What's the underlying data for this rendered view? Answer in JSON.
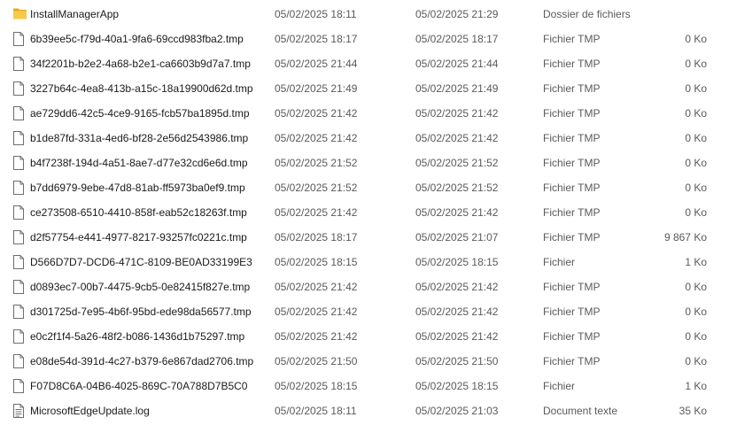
{
  "files": [
    {
      "icon": "folder-icon",
      "name": "InstallManagerApp",
      "created": "05/02/2025 18:11",
      "modified": "05/02/2025 21:29",
      "type": "Dossier de fichiers",
      "size": ""
    },
    {
      "icon": "file-icon",
      "name": "6b39ee5c-f79d-40a1-9fa6-69ccd983fba2.tmp",
      "created": "05/02/2025 18:17",
      "modified": "05/02/2025 18:17",
      "type": "Fichier TMP",
      "size": "0 Ko"
    },
    {
      "icon": "file-icon",
      "name": "34f2201b-b2e2-4a68-b2e1-ca6603b9d7a7.tmp",
      "created": "05/02/2025 21:44",
      "modified": "05/02/2025 21:44",
      "type": "Fichier TMP",
      "size": "0 Ko"
    },
    {
      "icon": "file-icon",
      "name": "3227b64c-4ea8-413b-a15c-18a19900d62d.tmp",
      "created": "05/02/2025 21:49",
      "modified": "05/02/2025 21:49",
      "type": "Fichier TMP",
      "size": "0 Ko"
    },
    {
      "icon": "file-icon",
      "name": "ae729dd6-42c5-4ce9-9165-fcb57ba1895d.tmp",
      "created": "05/02/2025 21:42",
      "modified": "05/02/2025 21:42",
      "type": "Fichier TMP",
      "size": "0 Ko"
    },
    {
      "icon": "file-icon",
      "name": "b1de87fd-331a-4ed6-bf28-2e56d2543986.tmp",
      "created": "05/02/2025 21:42",
      "modified": "05/02/2025 21:42",
      "type": "Fichier TMP",
      "size": "0 Ko"
    },
    {
      "icon": "file-icon",
      "name": "b4f7238f-194d-4a51-8ae7-d77e32cd6e6d.tmp",
      "created": "05/02/2025 21:52",
      "modified": "05/02/2025 21:52",
      "type": "Fichier TMP",
      "size": "0 Ko"
    },
    {
      "icon": "file-icon",
      "name": "b7dd6979-9ebe-47d8-81ab-ff5973ba0ef9.tmp",
      "created": "05/02/2025 21:52",
      "modified": "05/02/2025 21:52",
      "type": "Fichier TMP",
      "size": "0 Ko"
    },
    {
      "icon": "file-icon",
      "name": "ce273508-6510-4410-858f-eab52c18263f.tmp",
      "created": "05/02/2025 21:42",
      "modified": "05/02/2025 21:42",
      "type": "Fichier TMP",
      "size": "0 Ko"
    },
    {
      "icon": "file-icon",
      "name": "d2f57754-e441-4977-8217-93257fc0221c.tmp",
      "created": "05/02/2025 18:17",
      "modified": "05/02/2025 21:07",
      "type": "Fichier TMP",
      "size": "9 867 Ko"
    },
    {
      "icon": "file-icon",
      "name": "D566D7D7-DCD6-471C-8109-BE0AD33199E3",
      "created": "05/02/2025 18:15",
      "modified": "05/02/2025 18:15",
      "type": "Fichier",
      "size": "1 Ko"
    },
    {
      "icon": "file-icon",
      "name": "d0893ec7-00b7-4475-9cb5-0e82415f827e.tmp",
      "created": "05/02/2025 21:42",
      "modified": "05/02/2025 21:42",
      "type": "Fichier TMP",
      "size": "0 Ko"
    },
    {
      "icon": "file-icon",
      "name": "d301725d-7e95-4b6f-95bd-ede98da56577.tmp",
      "created": "05/02/2025 21:42",
      "modified": "05/02/2025 21:42",
      "type": "Fichier TMP",
      "size": "0 Ko"
    },
    {
      "icon": "file-icon",
      "name": "e0c2f1f4-5a26-48f2-b086-1436d1b75297.tmp",
      "created": "05/02/2025 21:42",
      "modified": "05/02/2025 21:42",
      "type": "Fichier TMP",
      "size": "0 Ko"
    },
    {
      "icon": "file-icon",
      "name": "e08de54d-391d-4c27-b379-6e867dad2706.tmp",
      "created": "05/02/2025 21:50",
      "modified": "05/02/2025 21:50",
      "type": "Fichier TMP",
      "size": "0 Ko"
    },
    {
      "icon": "file-icon",
      "name": "F07D8C6A-04B6-4025-869C-70A788D7B5C0",
      "created": "05/02/2025 18:15",
      "modified": "05/02/2025 18:15",
      "type": "Fichier",
      "size": "1 Ko"
    },
    {
      "icon": "text-file-icon",
      "name": "MicrosoftEdgeUpdate.log",
      "created": "05/02/2025 18:11",
      "modified": "05/02/2025 21:03",
      "type": "Document texte",
      "size": "35 Ko"
    }
  ],
  "colors": {
    "folder": "#f8c94a",
    "folder_dark": "#e6a817",
    "file_outline": "#6e6e6e",
    "secondary_text": "#5a5a5a"
  }
}
